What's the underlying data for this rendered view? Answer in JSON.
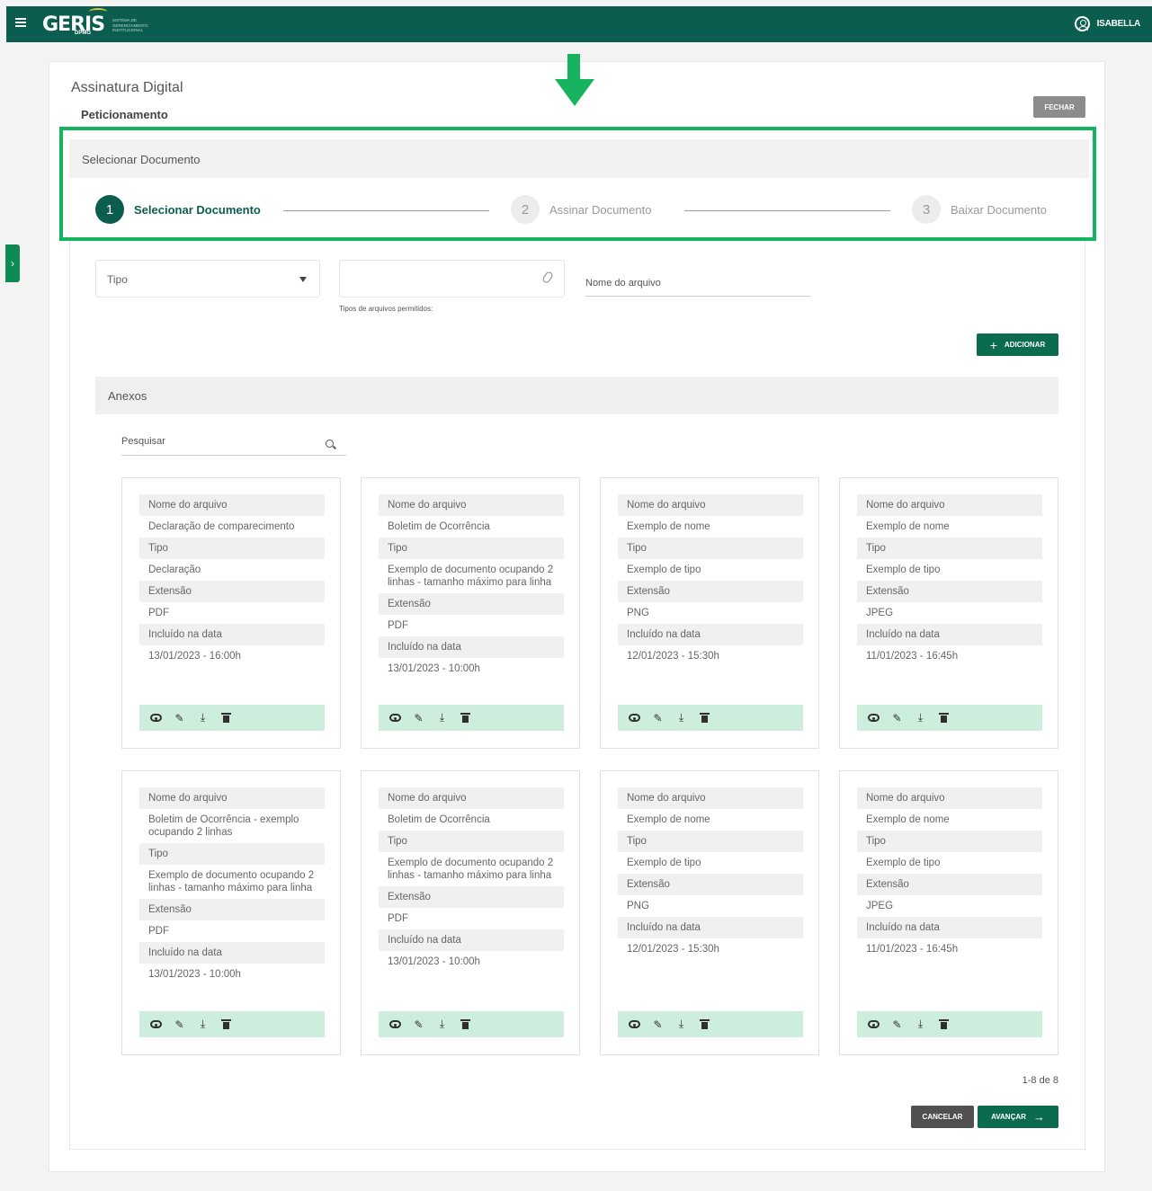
{
  "topbar": {
    "logo_text": "GERIS",
    "logo_sub": "DPMG",
    "logo_caption": "SISTEMA DE GERENCIAMENTO INSTITUCIONAL",
    "user_name": "ISABELLA"
  },
  "page": {
    "title": "Assinatura Digital",
    "subtitle": "Peticionamento",
    "close_label": "FECHAR"
  },
  "stepper": {
    "header": "Selecionar Documento",
    "steps": [
      {
        "number": "1",
        "label": "Selecionar Documento",
        "active": true
      },
      {
        "number": "2",
        "label": "Assinar Documento",
        "active": false
      },
      {
        "number": "3",
        "label": "Baixar Documento",
        "active": false
      }
    ]
  },
  "form": {
    "type_label": "Tipo",
    "file_hint": "Tipos de arquivos permitidos:",
    "filename_placeholder": "Nome do arquivo",
    "add_label": "ADICIONAR"
  },
  "attachments": {
    "title": "Anexos",
    "search_placeholder": "Pesquisar",
    "labels": {
      "name": "Nome do arquivo",
      "type": "Tipo",
      "extension": "Extensão",
      "date": "Incluído na data"
    },
    "cards": [
      {
        "name": "Declaração de comparecimento",
        "type": "Declaração",
        "extension": "PDF",
        "date": "13/01/2023 - 16:00h"
      },
      {
        "name": "Boletim de Ocorrência",
        "type": "Exemplo de documento ocupando 2 linhas - tamanho máximo para linha",
        "extension": "PDF",
        "date": "13/01/2023 - 10:00h"
      },
      {
        "name": "Exemplo de nome",
        "type": "Exemplo de tipo",
        "extension": "PNG",
        "date": "12/01/2023 - 15:30h"
      },
      {
        "name": "Exemplo de nome",
        "type": "Exemplo de tipo",
        "extension": "JPEG",
        "date": "11/01/2023 - 16:45h"
      },
      {
        "name": "Boletim de Ocorrência - exemplo ocupando 2 linhas",
        "type": "Exemplo de documento ocupando 2 linhas - tamanho máximo para linha",
        "extension": "PDF",
        "date": "13/01/2023 - 10:00h"
      },
      {
        "name": "Boletim de Ocorrência",
        "type": "Exemplo de documento ocupando 2 linhas - tamanho máximo para linha",
        "extension": "PDF",
        "date": "13/01/2023 - 10:00h"
      },
      {
        "name": "Exemplo de nome",
        "type": "Exemplo de tipo",
        "extension": "PNG",
        "date": "12/01/2023 - 15:30h"
      },
      {
        "name": "Exemplo de nome",
        "type": "Exemplo de tipo",
        "extension": "JPEG",
        "date": "11/01/2023 - 16:45h"
      }
    ],
    "pagination": "1-8 de 8"
  },
  "footer": {
    "cancel_label": "CANCELAR",
    "next_label": "AVANÇAR"
  },
  "colors": {
    "brand": "#0b5e4f",
    "highlight": "#17b45f",
    "action_bar": "#cdeedd"
  }
}
